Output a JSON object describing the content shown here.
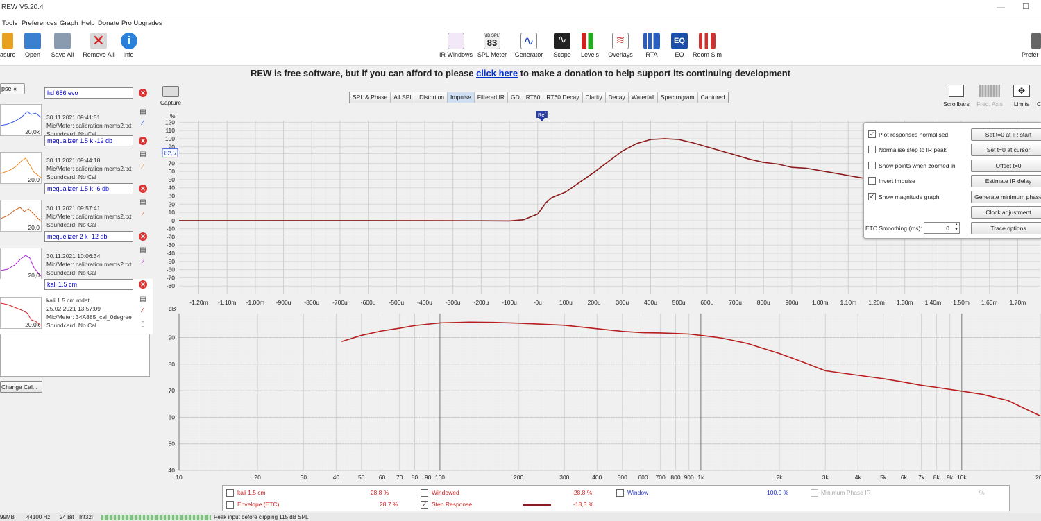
{
  "app": {
    "title": "REW V5.20.4"
  },
  "menu": [
    "Tools",
    "Preferences",
    "Graph",
    "Help",
    "Donate",
    "Pro Upgrades"
  ],
  "toolbar_left": [
    {
      "label": "asure",
      "icon": "measure-icon"
    },
    {
      "label": "Open",
      "icon": "folder-icon"
    },
    {
      "label": "Save All",
      "icon": "save-icon"
    },
    {
      "label": "Remove All",
      "icon": "remove-icon"
    },
    {
      "label": "Info",
      "icon": "info-icon"
    }
  ],
  "toolbar_center": [
    {
      "label": "IR Windows",
      "icon": "ir-windows-icon"
    },
    {
      "label": "SPL Meter",
      "icon": "spl-meter-icon",
      "value": "83",
      "unit": "dB SPL"
    },
    {
      "label": "Generator",
      "icon": "generator-icon"
    },
    {
      "label": "Scope",
      "icon": "scope-icon"
    },
    {
      "label": "Levels",
      "icon": "levels-icon"
    },
    {
      "label": "Overlays",
      "icon": "overlays-icon"
    },
    {
      "label": "RTA",
      "icon": "rta-icon"
    },
    {
      "label": "EQ",
      "icon": "eq-icon"
    },
    {
      "label": "Room Sim",
      "icon": "room-sim-icon"
    }
  ],
  "toolbar_right": {
    "label": "Prefer"
  },
  "banner": {
    "before": "REW is free software, but if you can afford to please ",
    "link": "click here",
    "after": " to make a donation to help support its continuing development"
  },
  "left_panel": {
    "collapse_label": "pse",
    "change_cal_label": "Change Cal...",
    "measurements": [
      {
        "name": "hd 686 evo",
        "date": "30.11.2021 09:41:51",
        "mic": "Mic/Meter: calibration mems2.txt",
        "soundcard": "Soundcard: No Cal",
        "thumb_label": "20,0k",
        "color": "#3355ee"
      },
      {
        "name": "mequalizer 1.5 k -12 db",
        "date": "30.11.2021 09:44:18",
        "mic": "Mic/Meter: calibration mems2.txt",
        "soundcard": "Soundcard: No Cal",
        "thumb_label": "20,0",
        "color": "#ee8822"
      },
      {
        "name": "mequalizer 1.5 k -6 db",
        "date": "30.11.2021 09:57:41",
        "mic": "Mic/Meter: calibration mems2.txt",
        "soundcard": "Soundcard: No Cal",
        "thumb_label": "20,0",
        "color": "#cc6622"
      },
      {
        "name": "mequelizer 2 k -12 db",
        "date": "30.11.2021 10:06:34",
        "mic": "Mic/Meter: calibration mems2.txt",
        "soundcard": "Soundcard: No Cal",
        "thumb_label": "20,0",
        "color": "#aa22cc"
      },
      {
        "name": "kali 1.5 cm",
        "file": "kali 1.5 cm.mdat",
        "date": "25.02.2021 13:57:09",
        "mic": "Mic/Meter: 34A885_cal_0degree",
        "soundcard": "Soundcard: No Cal",
        "thumb_label": "20,0k",
        "color": "#cc2222"
      }
    ]
  },
  "capture": {
    "label": "Capture"
  },
  "graph_tabs": [
    "SPL & Phase",
    "All SPL",
    "Distortion",
    "Impulse",
    "Filtered IR",
    "GD",
    "RT60",
    "RT60 Decay",
    "Clarity",
    "Decay",
    "Waterfall",
    "Spectrogram",
    "Captured"
  ],
  "active_tab": "Impulse",
  "right_tools": [
    {
      "label": "Scrollbars",
      "icon": "scrollbars-icon"
    },
    {
      "label": "Freq. Axis",
      "icon": "freq-axis-icon",
      "disabled": true
    },
    {
      "label": "Limits",
      "icon": "limits-icon"
    },
    {
      "label": "C",
      "icon": "controls-icon"
    }
  ],
  "chart_data": [
    {
      "type": "line",
      "ylabel": "%",
      "xlabel": "",
      "yticks": [
        120,
        110,
        100,
        90,
        80,
        70,
        60,
        50,
        40,
        30,
        20,
        10,
        0,
        -10,
        -20,
        -30,
        -40,
        -50,
        -60,
        -70,
        -80
      ],
      "xtick_labels": [
        "-1,20m",
        "-1,10m",
        "-1,00m",
        "-900u",
        "-800u",
        "-700u",
        "-600u",
        "-500u",
        "-400u",
        "-300u",
        "-200u",
        "-100u",
        "-0u",
        "100u",
        "200u",
        "300u",
        "400u",
        "500u",
        "600u",
        "700u",
        "800u",
        "900u",
        "1,00m",
        "1,10m",
        "1,20m",
        "1,30m",
        "1,40m",
        "1,50m",
        "1,60m",
        "1,70m"
      ],
      "xlim_s": [
        -0.00127,
        0.00178
      ],
      "ylim": [
        -90,
        122
      ],
      "marker_label": "Ref",
      "marker_x_s": 1.5e-05,
      "cursor_value": "82,5",
      "cursor_y": 82.5,
      "series": [
        {
          "x_s": [
            -0.00127,
            -0.0006,
            -0.0002,
            -0.0001,
            -5e-05,
            0,
            3e-05,
            5e-05,
            0.0001,
            0.00015,
            0.0002,
            0.00025,
            0.0003,
            0.00035,
            0.0004,
            0.00045,
            0.0005,
            0.00055,
            0.0006,
            0.00065,
            0.0007,
            0.00075,
            0.0008,
            0.00085,
            0.0009,
            0.00095,
            0.001,
            0.00105,
            0.0011,
            0.00115,
            0.00118
          ],
          "y": [
            0,
            0,
            -0.3,
            -0.5,
            1,
            8,
            22,
            28,
            35,
            47,
            59,
            72,
            85,
            94,
            99,
            100,
            99,
            95,
            90,
            85,
            80,
            75,
            71,
            69,
            65,
            64,
            61,
            58,
            55,
            52,
            50
          ],
          "color": "#8b1a1a"
        }
      ]
    },
    {
      "type": "line",
      "ylabel": "dB",
      "xlabel": "",
      "xscale": "log",
      "yticks": [
        90,
        80,
        70,
        60,
        50,
        40
      ],
      "ylim": [
        40,
        99
      ],
      "xlim": [
        10,
        20000
      ],
      "xtick_labels": [
        "10",
        "20",
        "30",
        "40",
        "50",
        "60",
        "70",
        "80",
        "90",
        "100",
        "200",
        "300",
        "400",
        "500",
        "600",
        "700",
        "800",
        "900",
        "1k",
        "2k",
        "3k",
        "4k",
        "5k",
        "6k",
        "7k",
        "8k",
        "9k",
        "10k",
        "20k"
      ],
      "series": [
        {
          "x": [
            42,
            50,
            60,
            70,
            80,
            100,
            130,
            160,
            200,
            300,
            400,
            500,
            600,
            700,
            800,
            900,
            1000,
            1200,
            1500,
            2000,
            2500,
            3000,
            4000,
            5000,
            6000,
            7000,
            8000,
            10000,
            12000,
            15000,
            20000
          ],
          "y": [
            88.5,
            90.8,
            92.5,
            93.5,
            94.5,
            95.5,
            95.8,
            95.7,
            95.4,
            94.6,
            93.3,
            92.3,
            91.8,
            91.7,
            91.5,
            91.3,
            90.8,
            89.8,
            87.8,
            84,
            80.5,
            77.5,
            75.8,
            74.5,
            73.2,
            72,
            71.2,
            69.8,
            68.6,
            66.3,
            60.5
          ],
          "color": "#b81e1e"
        }
      ]
    }
  ],
  "controls": {
    "checks": [
      {
        "label": "Plot responses normalised",
        "checked": true
      },
      {
        "label": "Normalise step to IR peak",
        "checked": false
      },
      {
        "label": "Show points when zoomed in",
        "checked": false
      },
      {
        "label": "Invert impulse",
        "checked": false
      },
      {
        "label": "Show magnitude graph",
        "checked": true
      }
    ],
    "smoothing_label": "ETC Smoothing (ms):",
    "smoothing_value": "0",
    "buttons": [
      "Set t=0 at IR start",
      "Set t=0 at cursor",
      "Offset t=0",
      "Estimate IR delay",
      "Generate minimum phase",
      "Clock adjustment",
      "Trace options"
    ]
  },
  "legend": [
    {
      "label": "kali 1.5 cm",
      "value": "-28,8 %",
      "checked": false,
      "color": "#cc2222"
    },
    {
      "label": "Windowed",
      "value": "-28,8 %",
      "checked": false,
      "color": "#cc2222"
    },
    {
      "label": "Window",
      "value": "100,0 %",
      "checked": false,
      "color": "#2233cc"
    },
    {
      "label": "Minimum Phase IR",
      "value": "%",
      "checked": false,
      "color": "#aaaaaa"
    },
    {
      "label": "Envelope (ETC)",
      "value": "28,7 %",
      "checked": false,
      "color": "#cc2222"
    },
    {
      "label": "Step Response",
      "value": "-18,3 %",
      "checked": true,
      "color": "#cc2222"
    }
  ],
  "status": {
    "memory": "99MB",
    "rate": "44100 Hz",
    "bits": "24 Bit",
    "format": "Int32I",
    "message": "Peak input before clipping 115 dB SPL"
  }
}
